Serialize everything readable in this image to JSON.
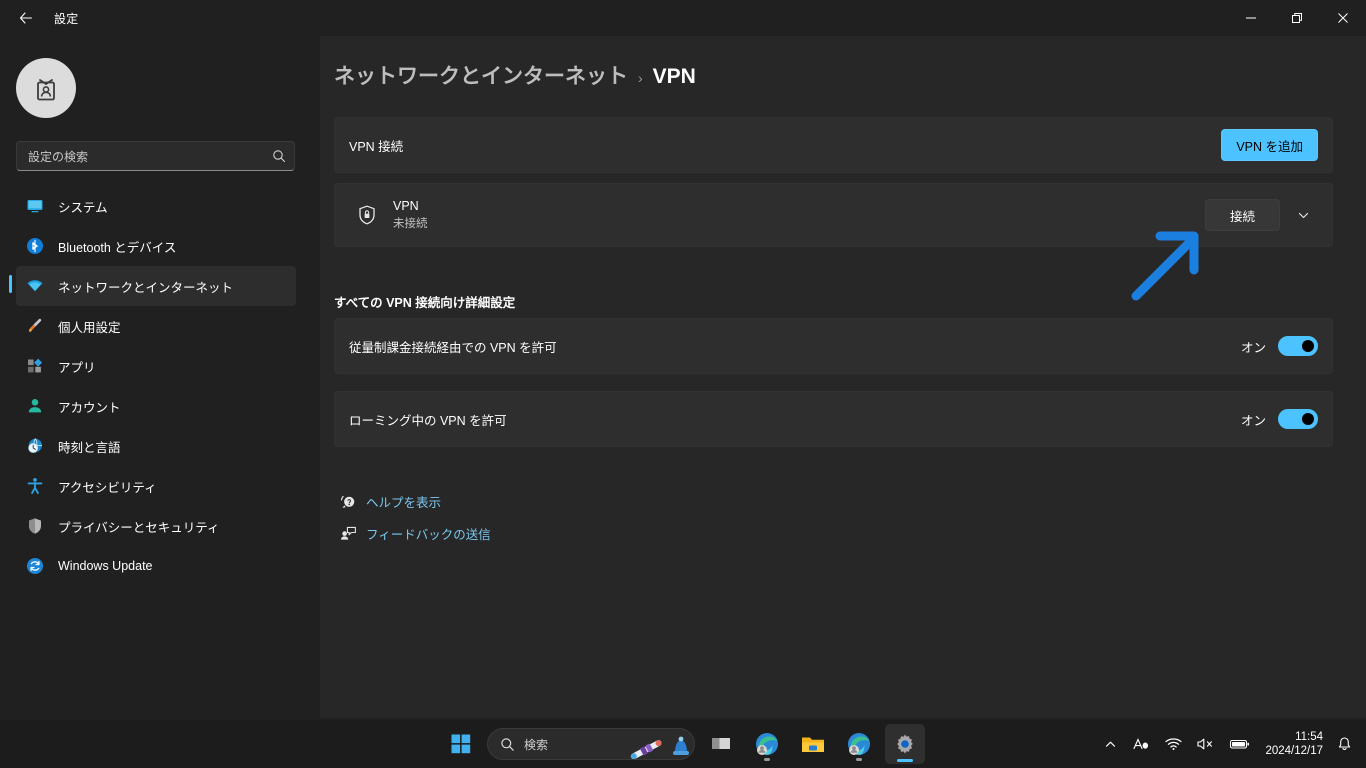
{
  "window": {
    "title": "設定",
    "back_label": "戻る",
    "minimize_label": "最小化",
    "maximize_label": "元のサイズに戻す",
    "close_label": "閉じる"
  },
  "sidebar": {
    "avatar_name": "id-badge-avatar",
    "search": {
      "placeholder": "設定の検索"
    },
    "items": [
      {
        "label": "システム",
        "icon": "monitor-icon",
        "selected": false
      },
      {
        "label": "Bluetooth とデバイス",
        "icon": "bluetooth-icon",
        "selected": false
      },
      {
        "label": "ネットワークとインターネット",
        "icon": "wifi-icon",
        "selected": true
      },
      {
        "label": "個人用設定",
        "icon": "paintbrush-icon",
        "selected": false
      },
      {
        "label": "アプリ",
        "icon": "apps-icon",
        "selected": false
      },
      {
        "label": "アカウント",
        "icon": "account-icon",
        "selected": false
      },
      {
        "label": "時刻と言語",
        "icon": "clock-globe-icon",
        "selected": false
      },
      {
        "label": "アクセシビリティ",
        "icon": "accessibility-icon",
        "selected": false
      },
      {
        "label": "プライバシーとセキュリティ",
        "icon": "shield-icon",
        "selected": false
      },
      {
        "label": "Windows Update",
        "icon": "update-icon",
        "selected": false
      }
    ]
  },
  "breadcrumb": {
    "parent": "ネットワークとインターネット",
    "separator": "›",
    "current": "VPN"
  },
  "main": {
    "vpn_connections": {
      "label": "VPN 接続",
      "add_button": "VPN を追加"
    },
    "vpn_entry": {
      "icon": "vpn-shield-icon",
      "name": "VPN",
      "status": "未接続",
      "connect_button": "接続",
      "expand_icon": "chevron-down-icon"
    },
    "advanced": {
      "section_title": "すべての VPN 接続向け詳細設定",
      "settings": [
        {
          "label": "従量制課金接続経由での VPN を許可",
          "state": "オン",
          "on": true
        },
        {
          "label": "ローミング中の VPN を許可",
          "state": "オン",
          "on": true
        }
      ]
    },
    "links": [
      {
        "label": "ヘルプを表示",
        "icon": "help-icon"
      },
      {
        "label": "フィードバックの送信",
        "icon": "feedback-icon"
      }
    ],
    "annotation": {
      "name": "arrow-annotation",
      "color": "#1b7fe0"
    }
  },
  "taskbar": {
    "start_label": "スタート",
    "search": {
      "placeholder": "検索"
    },
    "items": [
      {
        "name": "task-view",
        "label": "タスク ビュー"
      },
      {
        "name": "edge-profile-1",
        "label": "Microsoft Edge"
      },
      {
        "name": "file-explorer",
        "label": "エクスプローラー"
      },
      {
        "name": "edge-profile-2",
        "label": "Microsoft Edge"
      },
      {
        "name": "settings-app",
        "label": "設定"
      }
    ],
    "tray": {
      "overflow_icon": "chevron-up-icon",
      "ime_icon": "ime-icon",
      "wifi_icon": "wifi-icon",
      "volume_icon": "volume-muted-icon",
      "battery_icon": "battery-icon",
      "time": "11:54",
      "date": "2024/12/17",
      "notification_icon": "bell-icon"
    }
  },
  "colors": {
    "accent": "#4cc2ff",
    "link": "#7bc8f0",
    "page_bg": "#272727",
    "card_bg": "#2e2e2e",
    "sidebar_bg": "#202020"
  }
}
